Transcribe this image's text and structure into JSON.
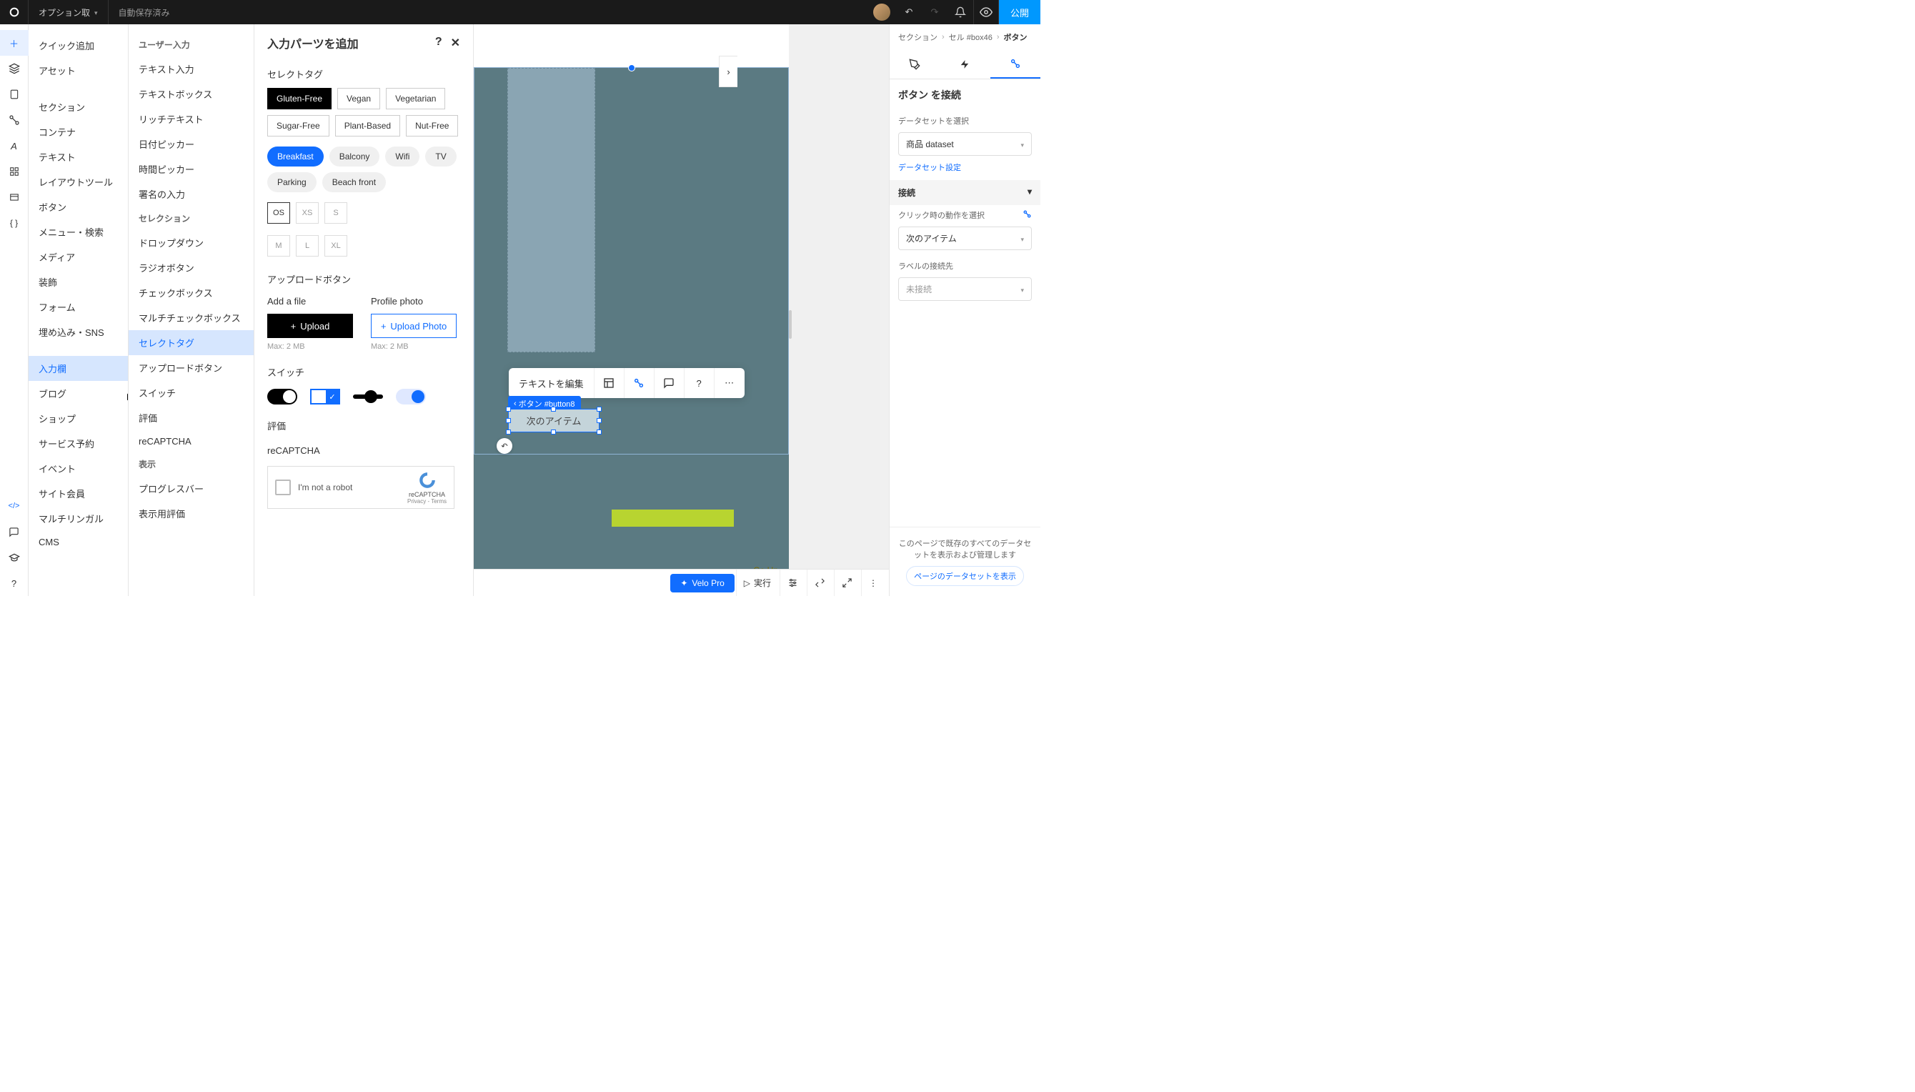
{
  "topbar": {
    "option_label": "オプション取",
    "autosave": "自動保存済み",
    "publish": "公開"
  },
  "panel1_items": [
    {
      "label": "クイック追加"
    },
    {
      "label": "アセット",
      "sep_after": true
    },
    {
      "label": "セクション"
    },
    {
      "label": "コンテナ"
    },
    {
      "label": "テキスト"
    },
    {
      "label": "レイアウトツール"
    },
    {
      "label": "ボタン"
    },
    {
      "label": "メニュー・検索"
    },
    {
      "label": "メディア"
    },
    {
      "label": "装飾"
    },
    {
      "label": "フォーム"
    },
    {
      "label": "埋め込み・SNS",
      "sep_after": true
    },
    {
      "label": "入力欄",
      "selected": true
    },
    {
      "label": "ブログ"
    },
    {
      "label": "ショップ"
    },
    {
      "label": "サービス予約"
    },
    {
      "label": "イベント"
    },
    {
      "label": "サイト会員"
    },
    {
      "label": "マルチリンガル"
    },
    {
      "label": "CMS"
    }
  ],
  "panel2_groups": [
    {
      "head": "ユーザー入力",
      "items": [
        {
          "label": "テキスト入力"
        },
        {
          "label": "テキストボックス"
        },
        {
          "label": "リッチテキスト"
        },
        {
          "label": "日付ピッカー"
        },
        {
          "label": "時間ピッカー"
        },
        {
          "label": "署名の入力"
        }
      ]
    },
    {
      "head": "セレクション",
      "items": [
        {
          "label": "ドロップダウン"
        },
        {
          "label": "ラジオボタン"
        },
        {
          "label": "チェックボックス"
        },
        {
          "label": "マルチチェックボックス"
        },
        {
          "label": "セレクトタグ",
          "selected": true
        },
        {
          "label": "アップロードボタン"
        },
        {
          "label": "スイッチ"
        },
        {
          "label": "評価"
        },
        {
          "label": "reCAPTCHA"
        }
      ]
    },
    {
      "head": "表示",
      "items": [
        {
          "label": "プログレスバー"
        },
        {
          "label": "表示用評価"
        }
      ]
    }
  ],
  "panel3": {
    "title": "入力パーツを追加",
    "sec_select": "セレクトタグ",
    "tags_style1": [
      "Gluten-Free",
      "Vegan",
      "Vegetarian",
      "Sugar-Free",
      "Plant-Based",
      "Nut-Free"
    ],
    "tags_style2": [
      "Breakfast",
      "Balcony",
      "Wifi",
      "TV",
      "Parking",
      "Beach front"
    ],
    "tags_style3": [
      "OS",
      "XS",
      "S",
      "M",
      "L",
      "XL"
    ],
    "sec_upload": "アップロードボタン",
    "upload": {
      "a_label": "Add a file",
      "a_btn": "Upload",
      "a_hint": "Max: 2 MB",
      "b_label": "Profile photo",
      "b_btn": "Upload Photo",
      "b_hint": "Max: 2 MB"
    },
    "sec_switch": "スイッチ",
    "sec_rating": "評価",
    "sec_recaptcha": "reCAPTCHA",
    "recaptcha_text": "I'm not a robot",
    "recaptcha_brand": "reCAPTCHA",
    "recaptcha_terms": "Privacy - Terms"
  },
  "canvas": {
    "edit_text": "テキストを編集",
    "button_tag": "ボタン #button8",
    "selected_btn_label": "次のアイテム",
    "go_up": "Go Up"
  },
  "dock": {
    "velo": "Velo Pro",
    "run": "実行"
  },
  "right": {
    "breadcrumb": [
      "セクション",
      "セル #box46",
      "ボタン"
    ],
    "title": "ボタン を接続",
    "dataset_label": "データセットを選択",
    "dataset_value": "商品 dataset",
    "dataset_settings": "データセット設定",
    "accordion": "接続",
    "click_label": "クリック時の動作を選択",
    "click_value": "次のアイテム",
    "label_label": "ラベルの接続先",
    "label_value": "未接続",
    "footer_text": "このページで既存のすべてのデータセットを表示および管理します",
    "footer_link": "ページのデータセットを表示"
  }
}
